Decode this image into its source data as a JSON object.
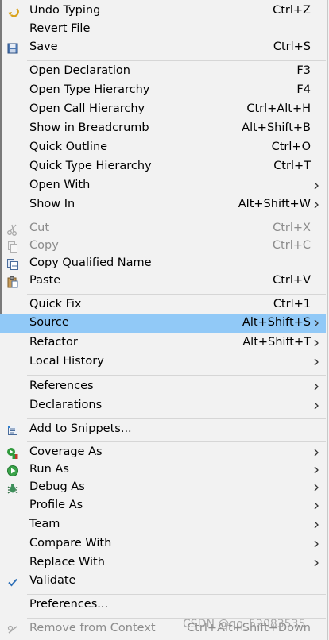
{
  "menu": {
    "undo_typing": {
      "label": "Undo Typing",
      "shortcut": "Ctrl+Z"
    },
    "revert_file": {
      "label": "Revert File"
    },
    "save": {
      "label": "Save",
      "shortcut": "Ctrl+S"
    },
    "open_declaration": {
      "label": "Open Declaration",
      "shortcut": "F3"
    },
    "open_type_hierarchy": {
      "label": "Open Type Hierarchy",
      "shortcut": "F4"
    },
    "open_call_hierarchy": {
      "label": "Open Call Hierarchy",
      "shortcut": "Ctrl+Alt+H"
    },
    "show_in_breadcrumb": {
      "label": "Show in Breadcrumb",
      "shortcut": "Alt+Shift+B"
    },
    "quick_outline": {
      "label": "Quick Outline",
      "shortcut": "Ctrl+O"
    },
    "quick_type_hierarchy": {
      "label": "Quick Type Hierarchy",
      "shortcut": "Ctrl+T"
    },
    "open_with": {
      "label": "Open With"
    },
    "show_in": {
      "label": "Show In",
      "shortcut": "Alt+Shift+W"
    },
    "cut": {
      "label": "Cut",
      "shortcut": "Ctrl+X"
    },
    "copy": {
      "label": "Copy",
      "shortcut": "Ctrl+C"
    },
    "copy_qualified_name": {
      "label": "Copy Qualified Name"
    },
    "paste": {
      "label": "Paste",
      "shortcut": "Ctrl+V"
    },
    "quick_fix": {
      "label": "Quick Fix",
      "shortcut": "Ctrl+1"
    },
    "source": {
      "label": "Source",
      "shortcut": "Alt+Shift+S"
    },
    "refactor": {
      "label": "Refactor",
      "shortcut": "Alt+Shift+T"
    },
    "local_history": {
      "label": "Local History"
    },
    "references": {
      "label": "References"
    },
    "declarations": {
      "label": "Declarations"
    },
    "add_to_snippets": {
      "label": "Add to Snippets..."
    },
    "coverage_as": {
      "label": "Coverage As"
    },
    "run_as": {
      "label": "Run As"
    },
    "debug_as": {
      "label": "Debug As"
    },
    "profile_as": {
      "label": "Profile As"
    },
    "team": {
      "label": "Team"
    },
    "compare_with": {
      "label": "Compare With"
    },
    "replace_with": {
      "label": "Replace With"
    },
    "validate": {
      "label": "Validate"
    },
    "preferences": {
      "label": "Preferences..."
    },
    "remove_from_context": {
      "label": "Remove from Context",
      "shortcut": "Ctrl+Alt+Shift+Down"
    }
  },
  "watermark": "CSDN @qq_52083535",
  "colors": {
    "highlight": "#91c9f7",
    "background": "#f2f2f2",
    "disabled_text": "#8c8c8c"
  }
}
